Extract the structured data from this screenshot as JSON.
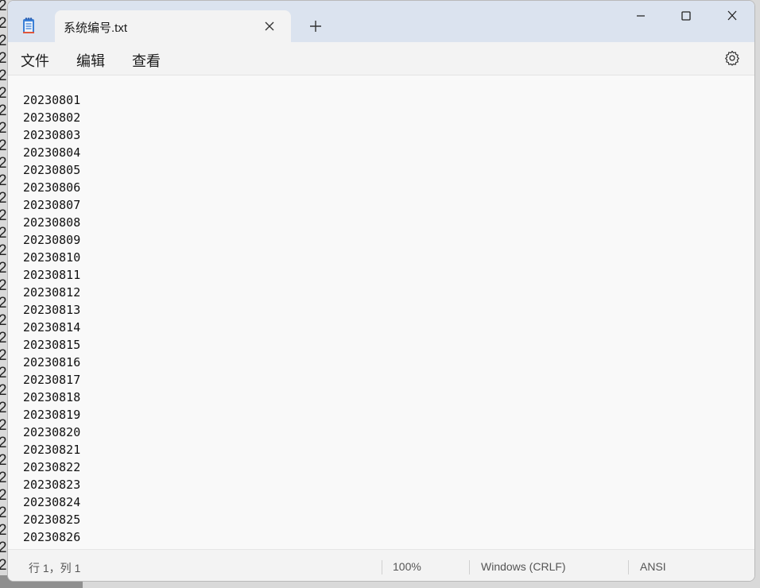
{
  "background": {
    "partial_text": [
      "2",
      "2",
      "2",
      "2",
      "2",
      "2",
      "2",
      "2",
      "2",
      "2",
      "2",
      "2",
      "2",
      "2",
      "2",
      "2",
      "2",
      "2",
      "2",
      "2",
      "2",
      "2",
      "2",
      "2",
      "2",
      "2",
      "2",
      "2",
      "2",
      "2",
      "2",
      "2",
      "2"
    ]
  },
  "window": {
    "tab_title": "系统编号.txt",
    "menu": {
      "file": "文件",
      "edit": "编辑",
      "view": "查看"
    }
  },
  "editor": {
    "lines": [
      "20230801",
      "20230802",
      "20230803",
      "20230804",
      "20230805",
      "20230806",
      "20230807",
      "20230808",
      "20230809",
      "20230810",
      "20230811",
      "20230812",
      "20230813",
      "20230814",
      "20230815",
      "20230816",
      "20230817",
      "20230818",
      "20230819",
      "20230820",
      "20230821",
      "20230822",
      "20230823",
      "20230824",
      "20230825",
      "20230826"
    ]
  },
  "status": {
    "position": "行 1，列 1",
    "zoom": "100%",
    "line_ending": "Windows (CRLF)",
    "encoding": "ANSI"
  },
  "icons": {
    "app": "notepad-icon",
    "close_tab": "close-icon",
    "new_tab": "plus-icon",
    "minimize": "minimize-icon",
    "maximize": "maximize-icon",
    "close_window": "close-icon",
    "settings": "gear-icon"
  },
  "colors": {
    "titlebar": "#dbe3ef",
    "tab": "#f3f3f3",
    "editor": "#f9f9f9",
    "accent": "#2f6fd1"
  }
}
